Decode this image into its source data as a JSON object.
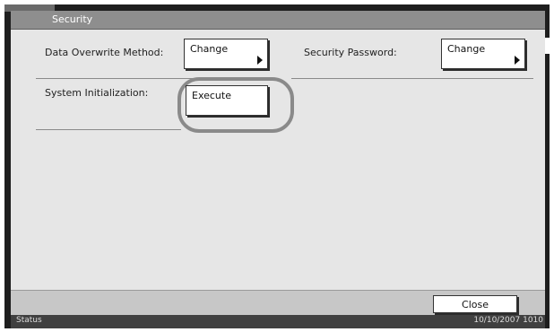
{
  "title": "Security",
  "settings": {
    "data_overwrite": {
      "label": "Data Overwrite Method:",
      "button": "Change"
    },
    "security_password": {
      "label": "Security Password:",
      "button": "Change"
    },
    "system_init": {
      "label": "System Initialization:",
      "button": "Execute"
    }
  },
  "footer": {
    "close_label": "Close"
  },
  "status_bar": {
    "status_label": "Status",
    "datetime": "10/10/2007  1010"
  }
}
